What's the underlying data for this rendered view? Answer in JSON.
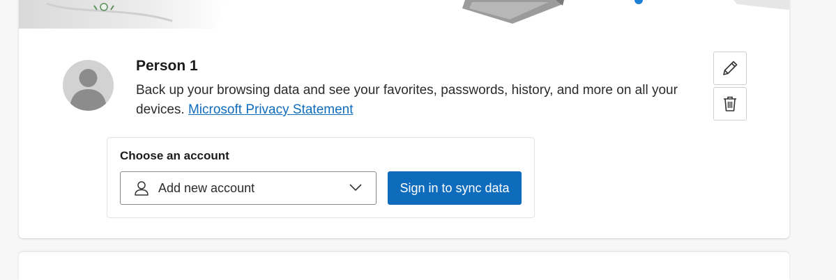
{
  "profile": {
    "name": "Person 1",
    "description": "Back up your browsing data and see your favorites, passwords, history, and more on all your devices.",
    "privacy_link": "Microsoft Privacy Statement"
  },
  "actions": {
    "edit_icon": "pencil-icon",
    "delete_icon": "trash-icon"
  },
  "account": {
    "title": "Choose an account",
    "selected": "Add new account",
    "sign_in_label": "Sign in to sync data"
  },
  "colors": {
    "accent": "#0f6cbd",
    "link": "#0f6cbd",
    "background": "#f7f7f7"
  }
}
